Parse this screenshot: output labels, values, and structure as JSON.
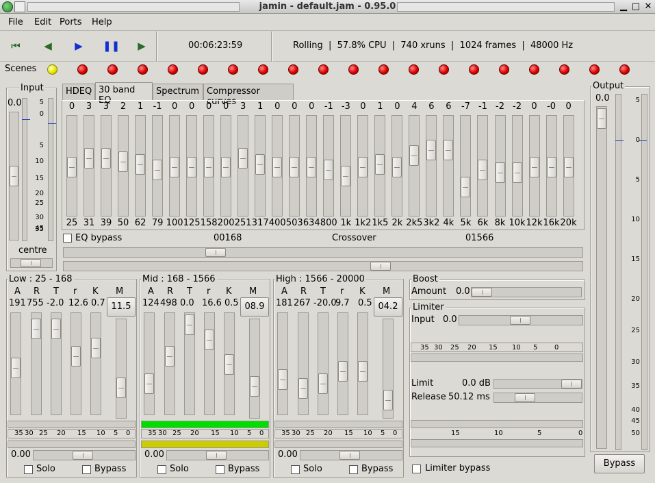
{
  "window": {
    "title": "jamin - default.jam - 0.95.0"
  },
  "menu": [
    "File",
    "Edit",
    "Ports",
    "Help"
  ],
  "transport": {
    "time": "00:06:23:59",
    "status": "Rolling  |  57.8% CPU  |  740 xruns  |  1024 frames  |  48000 Hz"
  },
  "scenes": {
    "label": "Scenes",
    "count": 20,
    "active": 0
  },
  "input": {
    "label": "Input",
    "value": "0.0",
    "pan_label": "centre",
    "scale": [
      "5",
      "0",
      "5",
      "10",
      "15",
      "20",
      "25",
      "30",
      "35",
      "45"
    ]
  },
  "tabs": [
    "HDEQ",
    "30 band EQ",
    "Spectrum",
    "Compressor curves"
  ],
  "eq": {
    "values": [
      "0",
      "3",
      "3",
      "2",
      "1",
      "-1",
      "0",
      "0",
      "0",
      "0",
      "3",
      "1",
      "0",
      "0",
      "0",
      "-1",
      "-3",
      "0",
      "1",
      "0",
      "4",
      "6",
      "6",
      "-7",
      "-1",
      "-2",
      "-2",
      "0",
      "-0",
      "0"
    ],
    "freqs": [
      "25",
      "31",
      "39",
      "50",
      "62",
      "79",
      "100",
      "125",
      "158",
      "200",
      "251",
      "317",
      "400",
      "503",
      "634",
      "800",
      "1k",
      "1k2",
      "1k5",
      "2k",
      "2k5",
      "3k2",
      "4k",
      "5k",
      "6k",
      "8k",
      "10k",
      "12k",
      "16k",
      "20k"
    ],
    "bypass_label": "EQ bypass",
    "crossover_label": "Crossover",
    "crossover_low": "00168",
    "crossover_high": "01566"
  },
  "bands": [
    {
      "title": "Low : 25 - 168",
      "heads": [
        "A",
        "R",
        "T",
        "r",
        "K",
        "M"
      ],
      "vals": [
        "191",
        "755",
        "-2.0",
        "12.6",
        "0.7"
      ],
      "m": "11.5",
      "gain": "0.00",
      "solo": "Solo",
      "bypass": "Bypass"
    },
    {
      "title": "Mid : 168 - 1566",
      "heads": [
        "A",
        "R",
        "T",
        "r",
        "K",
        "M"
      ],
      "vals": [
        "124",
        "498",
        "0.0",
        "16.6",
        "0.5"
      ],
      "m": "08.9",
      "gain": "0.00",
      "solo": "Solo",
      "bypass": "Bypass"
    },
    {
      "title": "High : 1566 - 20000",
      "heads": [
        "A",
        "R",
        "T",
        "r",
        "K",
        "M"
      ],
      "vals": [
        "181",
        "267",
        "-20.0",
        "9.7",
        "0.5"
      ],
      "m": "04.2",
      "gain": "0.00",
      "solo": "Solo",
      "bypass": "Bypass"
    }
  ],
  "meter_scale": [
    "35",
    "30",
    "25",
    "20",
    "15",
    "10",
    "5",
    "0"
  ],
  "boost": {
    "label": "Boost",
    "amount_label": "Amount",
    "amount": "0.0"
  },
  "limiter": {
    "label": "Limiter",
    "input_label": "Input",
    "input": "0.0",
    "scale": [
      "35",
      "30",
      "25",
      "20",
      "15",
      "10",
      "5",
      "0"
    ],
    "limit_label": "Limit",
    "limit": "0.0 dB",
    "release_label": "Release",
    "release": "50.12 ms",
    "scale2": [
      "15",
      "10",
      "5",
      "0"
    ],
    "bypass_label": "Limiter bypass"
  },
  "output": {
    "label": "Output",
    "value": "0.0",
    "scale": [
      "5",
      "0",
      "5",
      "10",
      "15",
      "20",
      "25",
      "30",
      "35",
      "40",
      "45",
      "50"
    ],
    "bypass": "Bypass"
  },
  "colors": {
    "led_on": "#e8e800",
    "led_off": "#d00000",
    "meter_green": "#00dd00",
    "meter_yellow": "#cccc00"
  }
}
